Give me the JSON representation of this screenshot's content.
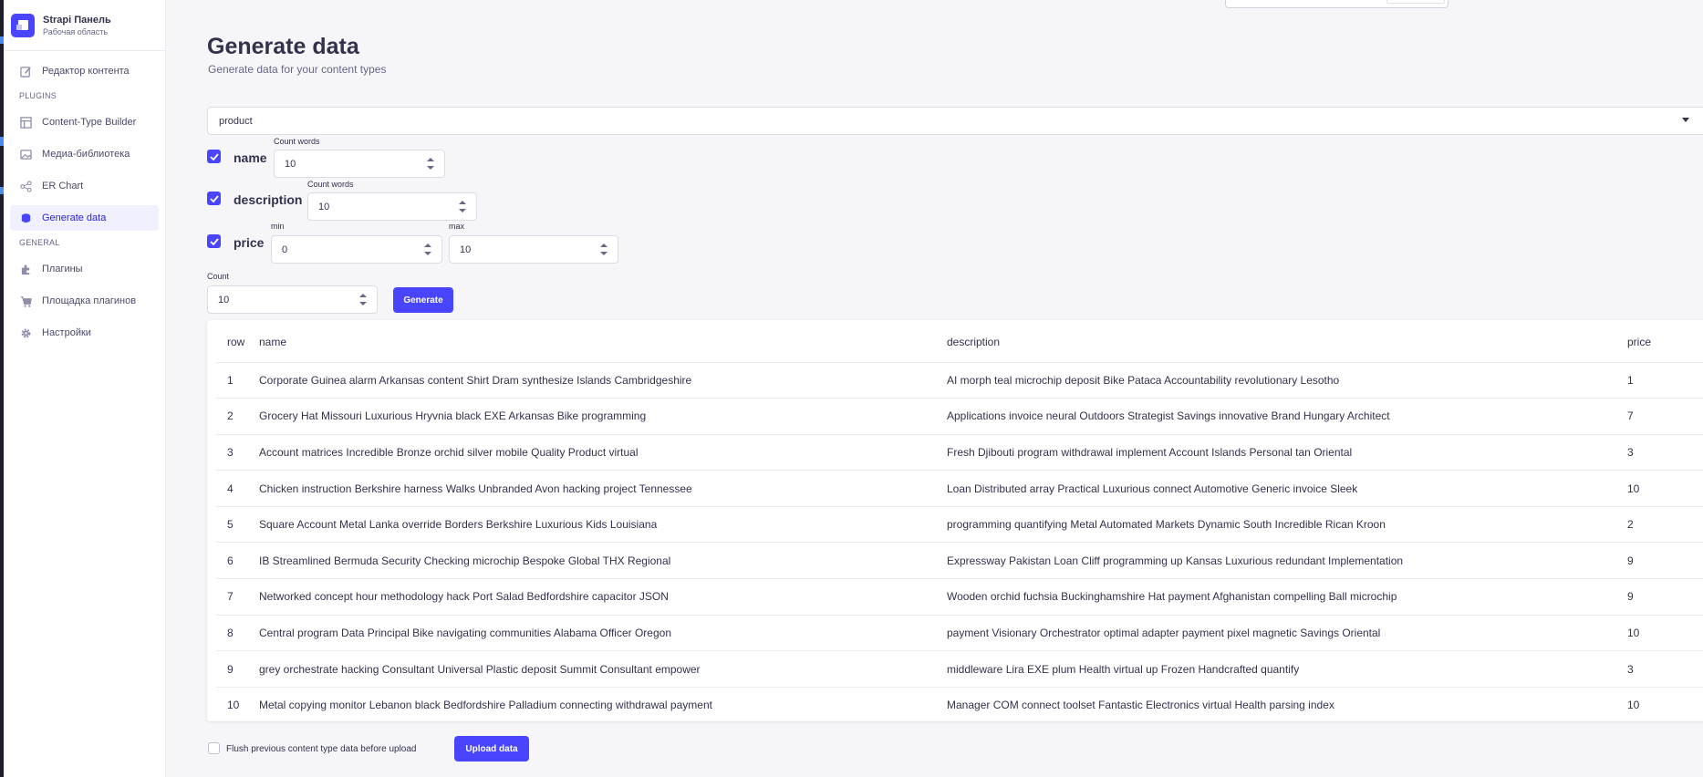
{
  "sidebar": {
    "brand_name": "Strapi Панель",
    "brand_sub": "Рабочая область",
    "items_top": [
      {
        "label": "Редактор контента",
        "icon": "pencil-icon"
      }
    ],
    "plugins_title": "PLUGINS",
    "plugins": [
      {
        "label": "Content-Type Builder",
        "icon": "layout-icon"
      },
      {
        "label": "Медиа-библиотека",
        "icon": "image-icon"
      },
      {
        "label": "ER Chart",
        "icon": "graph-icon"
      },
      {
        "label": "Generate data",
        "icon": "database-icon",
        "active": true
      }
    ],
    "general_title": "GENERAL",
    "general": [
      {
        "label": "Плагины",
        "icon": "puzzle-icon"
      },
      {
        "label": "Площадка плагинов",
        "icon": "cart-icon"
      },
      {
        "label": "Настройки",
        "icon": "gear-icon"
      }
    ]
  },
  "page": {
    "title": "Generate data",
    "subtitle": "Generate data for your content types"
  },
  "content_type_select": {
    "value": "product"
  },
  "fields": {
    "name": {
      "label": "name",
      "checked": true,
      "count_label": "Count words",
      "count_value": "10"
    },
    "description": {
      "label": "description",
      "checked": true,
      "count_label": "Count words",
      "count_value": "10"
    },
    "price": {
      "label": "price",
      "checked": true,
      "min_label": "min",
      "min_value": "0",
      "max_label": "max",
      "max_value": "10"
    }
  },
  "count": {
    "label": "Count",
    "value": "10"
  },
  "generate_button": "Generate",
  "table": {
    "headers": [
      "row",
      "name",
      "description",
      "price"
    ],
    "rows": [
      [
        "1",
        "Corporate Guinea alarm Arkansas content Shirt Dram synthesize Islands Cambridgeshire",
        "AI morph teal microchip deposit Bike Pataca Accountability revolutionary Lesotho",
        "1"
      ],
      [
        "2",
        "Grocery Hat Missouri Luxurious Hryvnia black EXE Arkansas Bike programming",
        "Applications invoice neural Outdoors Strategist Savings innovative Brand Hungary Architect",
        "7"
      ],
      [
        "3",
        "Account matrices Incredible Bronze orchid silver mobile Quality Product virtual",
        "Fresh Djibouti program withdrawal implement Account Islands Personal tan Oriental",
        "3"
      ],
      [
        "4",
        "Chicken instruction Berkshire harness Walks Unbranded Avon hacking project Tennessee",
        "Loan Distributed array Practical Luxurious connect Automotive Generic invoice Sleek",
        "10"
      ],
      [
        "5",
        "Square Account Metal Lanka override Borders Berkshire Luxurious Kids Louisiana",
        "programming quantifying Metal Automated Markets Dynamic South Incredible Rican Kroon",
        "2"
      ],
      [
        "6",
        "IB Streamlined Bermuda Security Checking microchip Bespoke Global THX Regional",
        "Expressway Pakistan Loan Cliff programming up Kansas Luxurious redundant Implementation",
        "9"
      ],
      [
        "7",
        "Networked concept hour methodology hack Port Salad Bedfordshire capacitor JSON",
        "Wooden orchid fuchsia Buckinghamshire Hat payment Afghanistan compelling Ball microchip",
        "9"
      ],
      [
        "8",
        "Central program Data Principal Bike navigating communities Alabama Officer Oregon",
        "payment Visionary Orchestrator optimal adapter payment pixel magnetic Savings Oriental",
        "10"
      ],
      [
        "9",
        "grey orchestrate hacking Consultant Universal Plastic deposit Summit Consultant empower",
        "middleware Lira EXE plum Health virtual up Frozen Handcrafted quantify",
        "3"
      ],
      [
        "10",
        "Metal copying monitor Lebanon black Bedfordshire Palladium connecting withdrawal payment",
        "Manager COM connect toolset Fantastic Electronics virtual Health parsing index",
        "10"
      ]
    ]
  },
  "flush": {
    "label": "Flush previous content type data before upload",
    "checked": false
  },
  "upload_button": "Upload data",
  "colors": {
    "accent": "#4945ff",
    "background": "#f6f6f9",
    "active_bg": "#f0f0ff"
  }
}
